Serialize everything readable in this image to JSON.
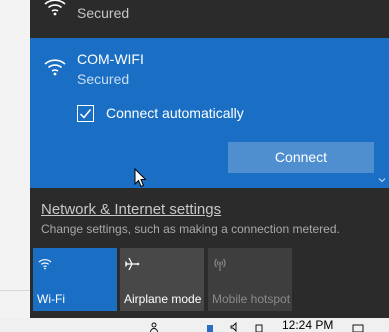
{
  "networks": {
    "previous": {
      "status": "Secured",
      "icon": "wifi-icon"
    },
    "selected": {
      "name": "COM-WIFI",
      "status": "Secured",
      "icon": "wifi-icon",
      "connect_automatically_label": "Connect automatically",
      "connect_automatically_checked": true,
      "connect_button": "Connect"
    }
  },
  "settings": {
    "link": "Network & Internet settings",
    "description": "Change settings, such as making a connection metered."
  },
  "quick_actions": [
    {
      "label": "Wi-Fi",
      "icon": "wifi-icon",
      "state": "on"
    },
    {
      "label": "Airplane mode",
      "icon": "airplane-icon",
      "state": "off"
    },
    {
      "label": "Mobile hotspot",
      "icon": "hotspot-icon",
      "state": "disabled"
    }
  ],
  "taskbar": {
    "time": "12:24 PM"
  },
  "colors": {
    "accent": "#1a6fc4",
    "flyout_bg": "#2b2b2b",
    "button": "#4f8fd0"
  }
}
